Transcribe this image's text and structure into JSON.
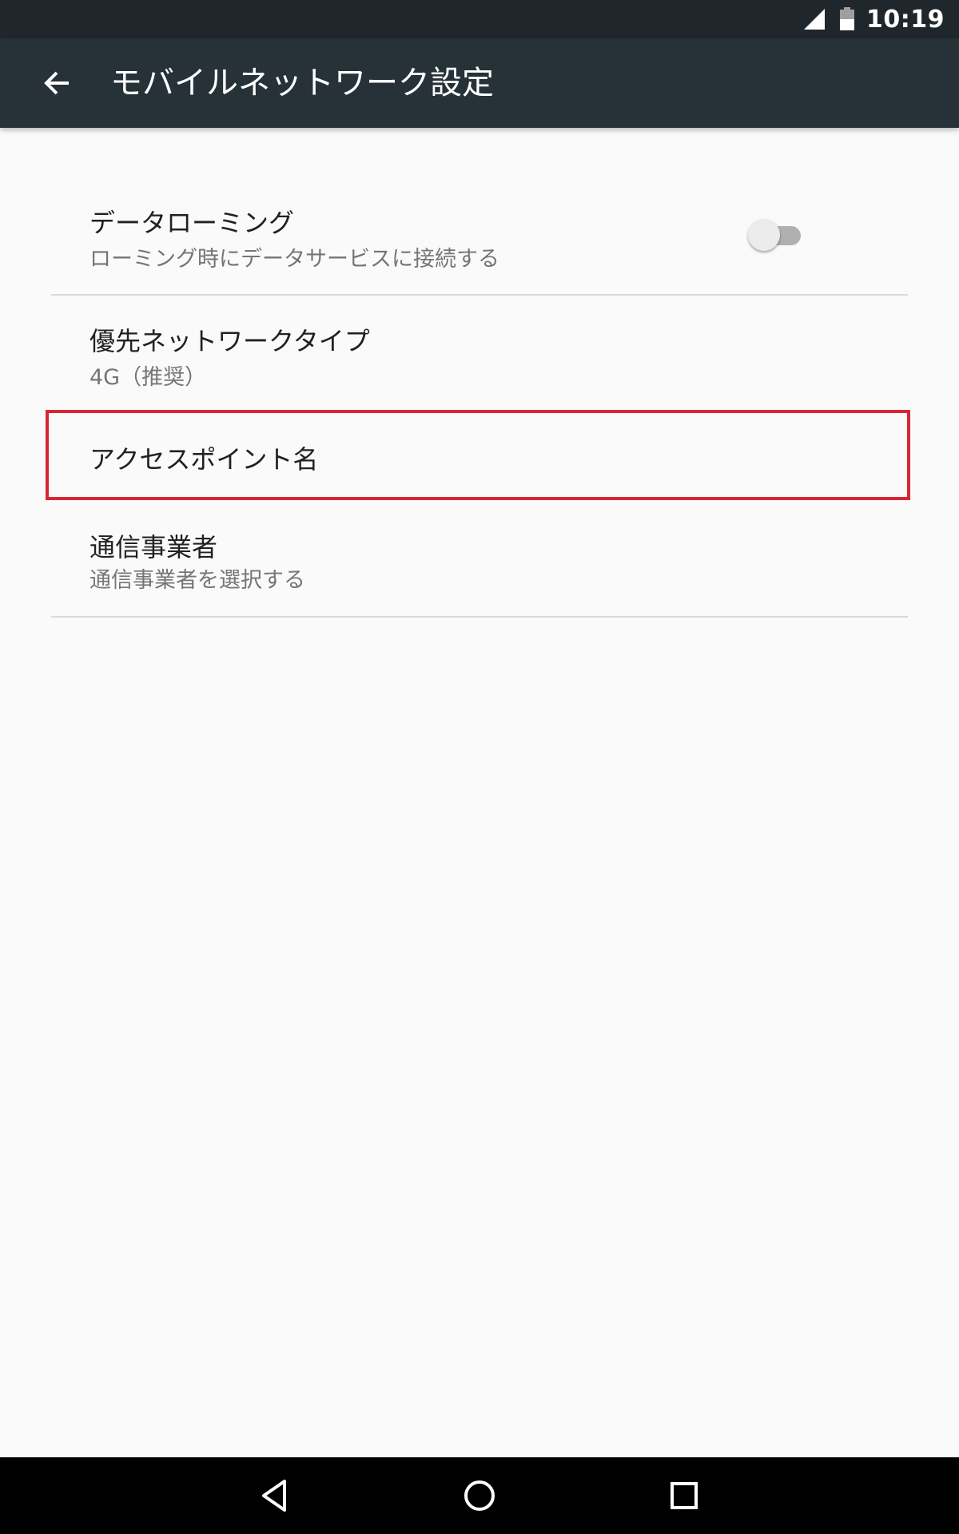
{
  "status_bar": {
    "time": "10:19",
    "icons": [
      "signal-icon",
      "battery-icon"
    ]
  },
  "app_bar": {
    "title": "モバイルネットワーク設定",
    "back_icon": "arrow-left-icon"
  },
  "settings": {
    "data_roaming": {
      "title": "データローミング",
      "summary": "ローミング時にデータサービスに接続する",
      "toggle_state": "off"
    },
    "preferred_network": {
      "title": "優先ネットワークタイプ",
      "summary": "4G（推奨）"
    },
    "access_point_names": {
      "title": "アクセスポイント名"
    },
    "carrier": {
      "title": "通信事業者",
      "summary": "通信事業者を選択する"
    }
  },
  "highlight_color": "#d72635",
  "nav_bar": {
    "icons": [
      "back-triangle-icon",
      "home-circle-icon",
      "recents-square-icon"
    ]
  }
}
